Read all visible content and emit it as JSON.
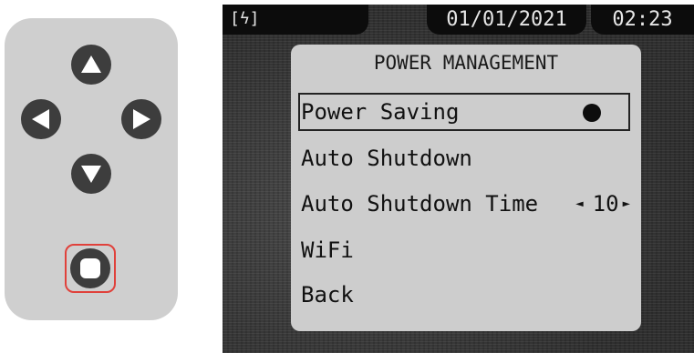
{
  "remote": {
    "buttons": [
      {
        "name": "up-button",
        "icon": "up-triangle-icon"
      },
      {
        "name": "left-button",
        "icon": "left-triangle-icon"
      },
      {
        "name": "right-button",
        "icon": "right-triangle-icon"
      },
      {
        "name": "down-button",
        "icon": "down-triangle-icon"
      },
      {
        "name": "ok-button",
        "icon": "square-icon",
        "highlighted": true
      }
    ],
    "highlight_color": "#e0413b"
  },
  "status_bar": {
    "battery_icon": "battery-charging-icon",
    "battery_glyph": "[ϟ]",
    "date": "01/01/2021",
    "time": "02:23"
  },
  "menu": {
    "title": "POWER MANAGEMENT",
    "items": [
      {
        "label": "Power Saving",
        "selected": true,
        "indicator": "filled-dot"
      },
      {
        "label": "Auto Shutdown"
      },
      {
        "label": "Auto Shutdown Time",
        "value": "10",
        "left_arrow": "◄",
        "right_arrow": "►"
      },
      {
        "label": "WiFi"
      },
      {
        "label": "Back"
      }
    ]
  }
}
